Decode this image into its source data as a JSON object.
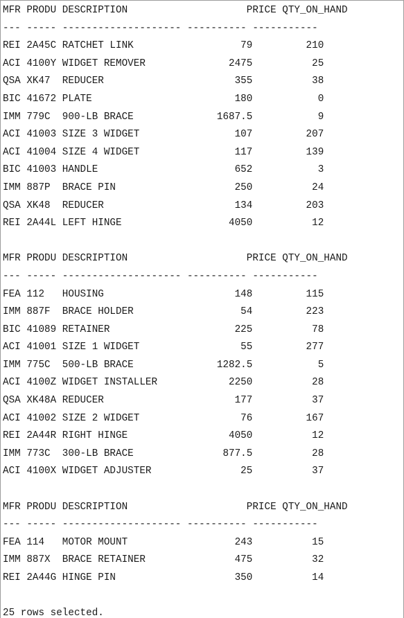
{
  "console": {
    "lines": [
      "MFR PRODU DESCRIPTION                    PRICE QTY_ON_HAND",
      "--- ----- -------------------- ---------- -----------",
      "REI 2A45C RATCHET LINK                  79         210",
      "ACI 4100Y WIDGET REMOVER              2475          25",
      "QSA XK47  REDUCER                      355          38",
      "BIC 41672 PLATE                        180           0",
      "IMM 779C  900-LB BRACE              1687.5           9",
      "ACI 41003 SIZE 3 WIDGET                107         207",
      "ACI 41004 SIZE 4 WIDGET                117         139",
      "BIC 41003 HANDLE                       652           3",
      "IMM 887P  BRACE PIN                    250          24",
      "QSA XK48  REDUCER                      134         203",
      "REI 2A44L LEFT HINGE                  4050          12",
      "",
      "MFR PRODU DESCRIPTION                    PRICE QTY_ON_HAND",
      "--- ----- -------------------- ---------- -----------",
      "FEA 112   HOUSING                      148         115",
      "IMM 887F  BRACE HOLDER                  54         223",
      "BIC 41089 RETAINER                     225          78",
      "ACI 41001 SIZE 1 WIDGET                 55         277",
      "IMM 775C  500-LB BRACE              1282.5           5",
      "ACI 4100Z WIDGET INSTALLER            2250          28",
      "QSA XK48A REDUCER                      177          37",
      "ACI 41002 SIZE 2 WIDGET                 76         167",
      "REI 2A44R RIGHT HINGE                 4050          12",
      "IMM 773C  300-LB BRACE               877.5          28",
      "ACI 4100X WIDGET ADJUSTER               25          37",
      "",
      "MFR PRODU DESCRIPTION                    PRICE QTY_ON_HAND",
      "--- ----- -------------------- ---------- -----------",
      "FEA 114   MOTOR MOUNT                  243          15",
      "IMM 887X  BRACE RETAINER               475          32",
      "REI 2A44G HINGE PIN                    350          14",
      "",
      "25 rows selected."
    ]
  }
}
